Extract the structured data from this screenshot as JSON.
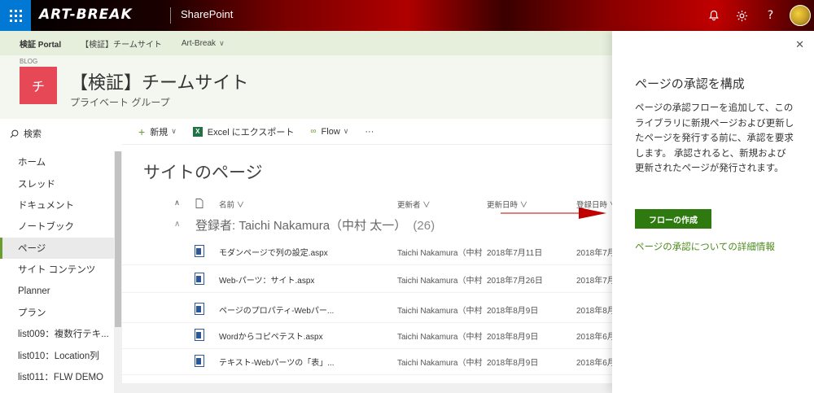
{
  "suitebar": {
    "brand": "ART-BREAK",
    "app_name": "SharePoint",
    "icons": [
      "bell-icon",
      "gear-icon",
      "help-icon",
      "avatar"
    ]
  },
  "hubnav": {
    "items": [
      "検証 Portal",
      "【検証】チームサイト",
      "Art-Break"
    ]
  },
  "site": {
    "label": "BLOG",
    "logo_letter": "チ",
    "logo_color": "#e74856",
    "title": "【検証】チームサイト",
    "subtitle": "プライベート グループ"
  },
  "leftnav": {
    "search": "検索",
    "items": [
      "ホーム",
      "スレッド",
      "ドキュメント",
      "ノートブック",
      "ページ",
      "サイト コンテンツ",
      "Planner",
      "プラン",
      "list009：複数行テキ...",
      "list010：Location列",
      "list011：FLW DEMO"
    ],
    "selected": "ページ"
  },
  "cmdbar": {
    "new": "新規",
    "excel": "Excel にエクスポート",
    "flow": "Flow",
    "more": "···"
  },
  "main": {
    "title": "サイトのページ",
    "columns": {
      "name": "名前",
      "modified_by": "更新者",
      "modified": "更新日時",
      "created": "登録日時"
    },
    "group": {
      "label": "登録者: Taichi Nakamura（中村 太一）",
      "count": "(26)"
    },
    "rows": [
      {
        "name": "モダンページで列の設定.aspx",
        "modified_by": "Taichi Nakamura（中村 太",
        "modified": "2018年7月11日",
        "created": "2018年7月"
      },
      {
        "name": "Web-パーツ：サイト.aspx",
        "modified_by": "Taichi Nakamura（中村 太",
        "modified": "2018年7月26日",
        "created": "2018年7月"
      },
      {
        "name": "ページのプロパティ-Webパー...",
        "modified_by": "Taichi Nakamura（中村 太",
        "modified": "2018年8月9日",
        "created": "2018年8月"
      },
      {
        "name": "Wordからコピペテスト.aspx",
        "modified_by": "Taichi Nakamura（中村 太",
        "modified": "2018年8月9日",
        "created": "2018年6月"
      },
      {
        "name": "テキスト-Webパーツの「表」...",
        "modified_by": "Taichi Nakamura（中村 太",
        "modified": "2018年8月9日",
        "created": "2018年6月"
      }
    ]
  },
  "panel": {
    "title": "ページの承認を構成",
    "description": "ページの承認フローを追加して、このライブラリに新規ページおよび更新したページを発行する前に、承認を要求します。 承認されると、新規および更新されたページが発行されます。",
    "button": "フローの作成",
    "link": "ページの承認についての詳細情報",
    "accent_color": "#2f7a10"
  }
}
